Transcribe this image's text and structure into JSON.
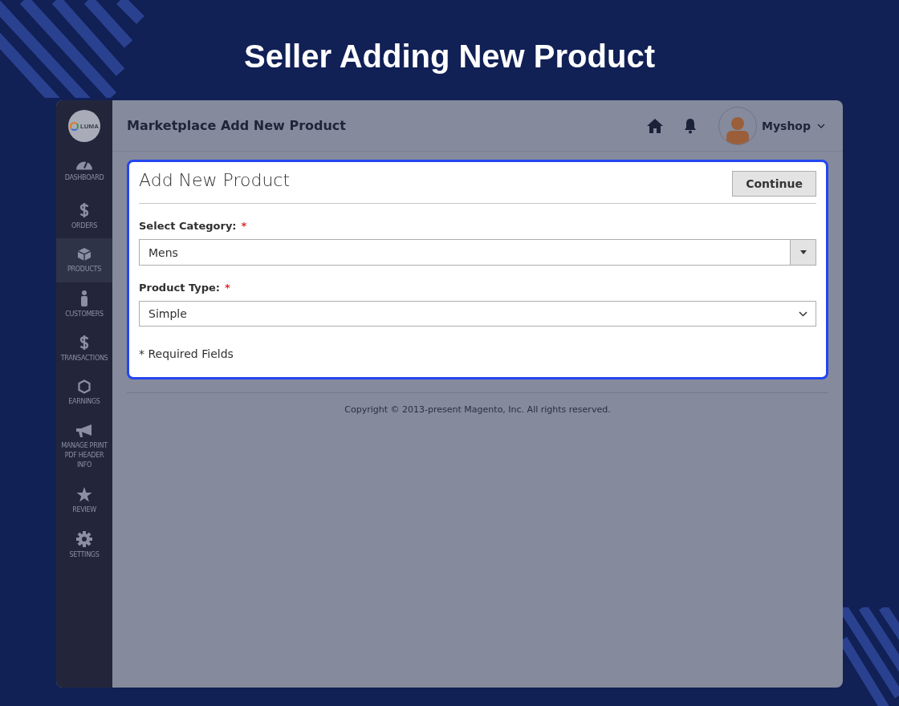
{
  "banner_title": "Seller Adding New Product",
  "sidebar": {
    "logo_text": "LUMA",
    "items": [
      {
        "label": "DASHBOARD",
        "selected": false
      },
      {
        "label": "ORDERS",
        "selected": false
      },
      {
        "label": "PRODUCTS",
        "selected": true
      },
      {
        "label": "CUSTOMERS",
        "selected": false
      },
      {
        "label": "TRANSACTIONS",
        "selected": false
      },
      {
        "label": "EARNINGS",
        "selected": false
      },
      {
        "label": "MANAGE PRINT PDF HEADER INFO",
        "selected": false
      },
      {
        "label": "REVIEW",
        "selected": false
      },
      {
        "label": "SETTINGS",
        "selected": false
      }
    ]
  },
  "header": {
    "title": "Marketplace Add New Product",
    "user": "Myshop"
  },
  "form": {
    "title": "Add New Product",
    "continue_button": "Continue",
    "fields": [
      {
        "kind": "combo",
        "label": "Select Category:",
        "required_mark": "*",
        "value": "Mens"
      },
      {
        "kind": "select",
        "label": "Product Type:",
        "required_mark": "*",
        "value": "Simple"
      }
    ],
    "required_note": "* Required Fields"
  },
  "footer": "Copyright © 2013-present Magento, Inc. All rights reserved."
}
